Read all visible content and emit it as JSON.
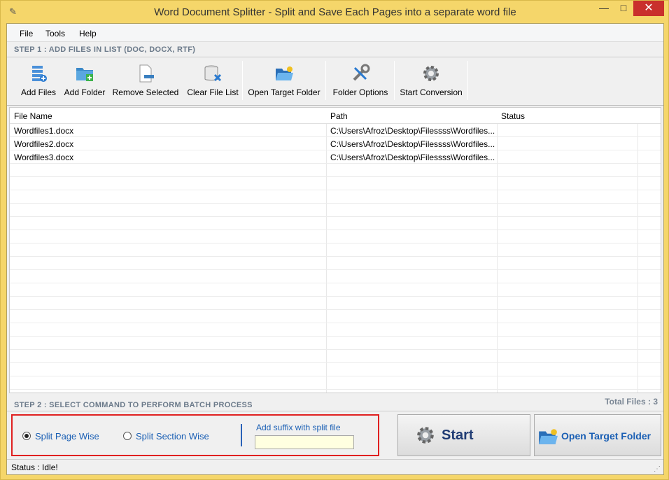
{
  "window": {
    "title": "Word Document Splitter - Split and Save Each Pages into a separate word file",
    "min_glyph": "—",
    "max_glyph": "□",
    "close_glyph": "✕"
  },
  "menu": {
    "file": "File",
    "tools": "Tools",
    "help": "Help"
  },
  "step1": "STEP 1 : ADD FILES IN LIST (DOC, DOCX, RTF)",
  "toolbar": {
    "add_files": "Add Files",
    "add_folder": "Add Folder",
    "remove_selected": "Remove Selected",
    "clear_file_list": "Clear File List",
    "open_target_folder": "Open Target Folder",
    "folder_options": "Folder Options",
    "start_conversion": "Start Conversion"
  },
  "grid": {
    "headers": {
      "file_name": "File Name",
      "path": "Path",
      "status": "Status"
    },
    "rows": [
      {
        "file_name": "Wordfiles1.docx",
        "path": "C:\\Users\\Afroz\\Desktop\\Filessss\\Wordfiles...",
        "status": ""
      },
      {
        "file_name": "Wordfiles2.docx",
        "path": "C:\\Users\\Afroz\\Desktop\\Filessss\\Wordfiles...",
        "status": ""
      },
      {
        "file_name": "Wordfiles3.docx",
        "path": "C:\\Users\\Afroz\\Desktop\\Filessss\\Wordfiles...",
        "status": ""
      }
    ]
  },
  "total_files": "Total Files : 3",
  "step2": "STEP 2 : SELECT COMMAND TO PERFORM BATCH PROCESS",
  "options": {
    "split_page_wise": "Split Page Wise",
    "split_section_wise": "Split Section Wise",
    "selected": "split_page_wise",
    "suffix_label": "Add suffix with split file",
    "suffix_value": ""
  },
  "buttons": {
    "start": "Start",
    "open_target_folder": "Open Target Folder"
  },
  "status": {
    "text": "Status  :  Idle!"
  },
  "colors": {
    "frame": "#f5d66a",
    "accent_blue": "#1a5fb4",
    "highlight_red": "#e02020"
  }
}
